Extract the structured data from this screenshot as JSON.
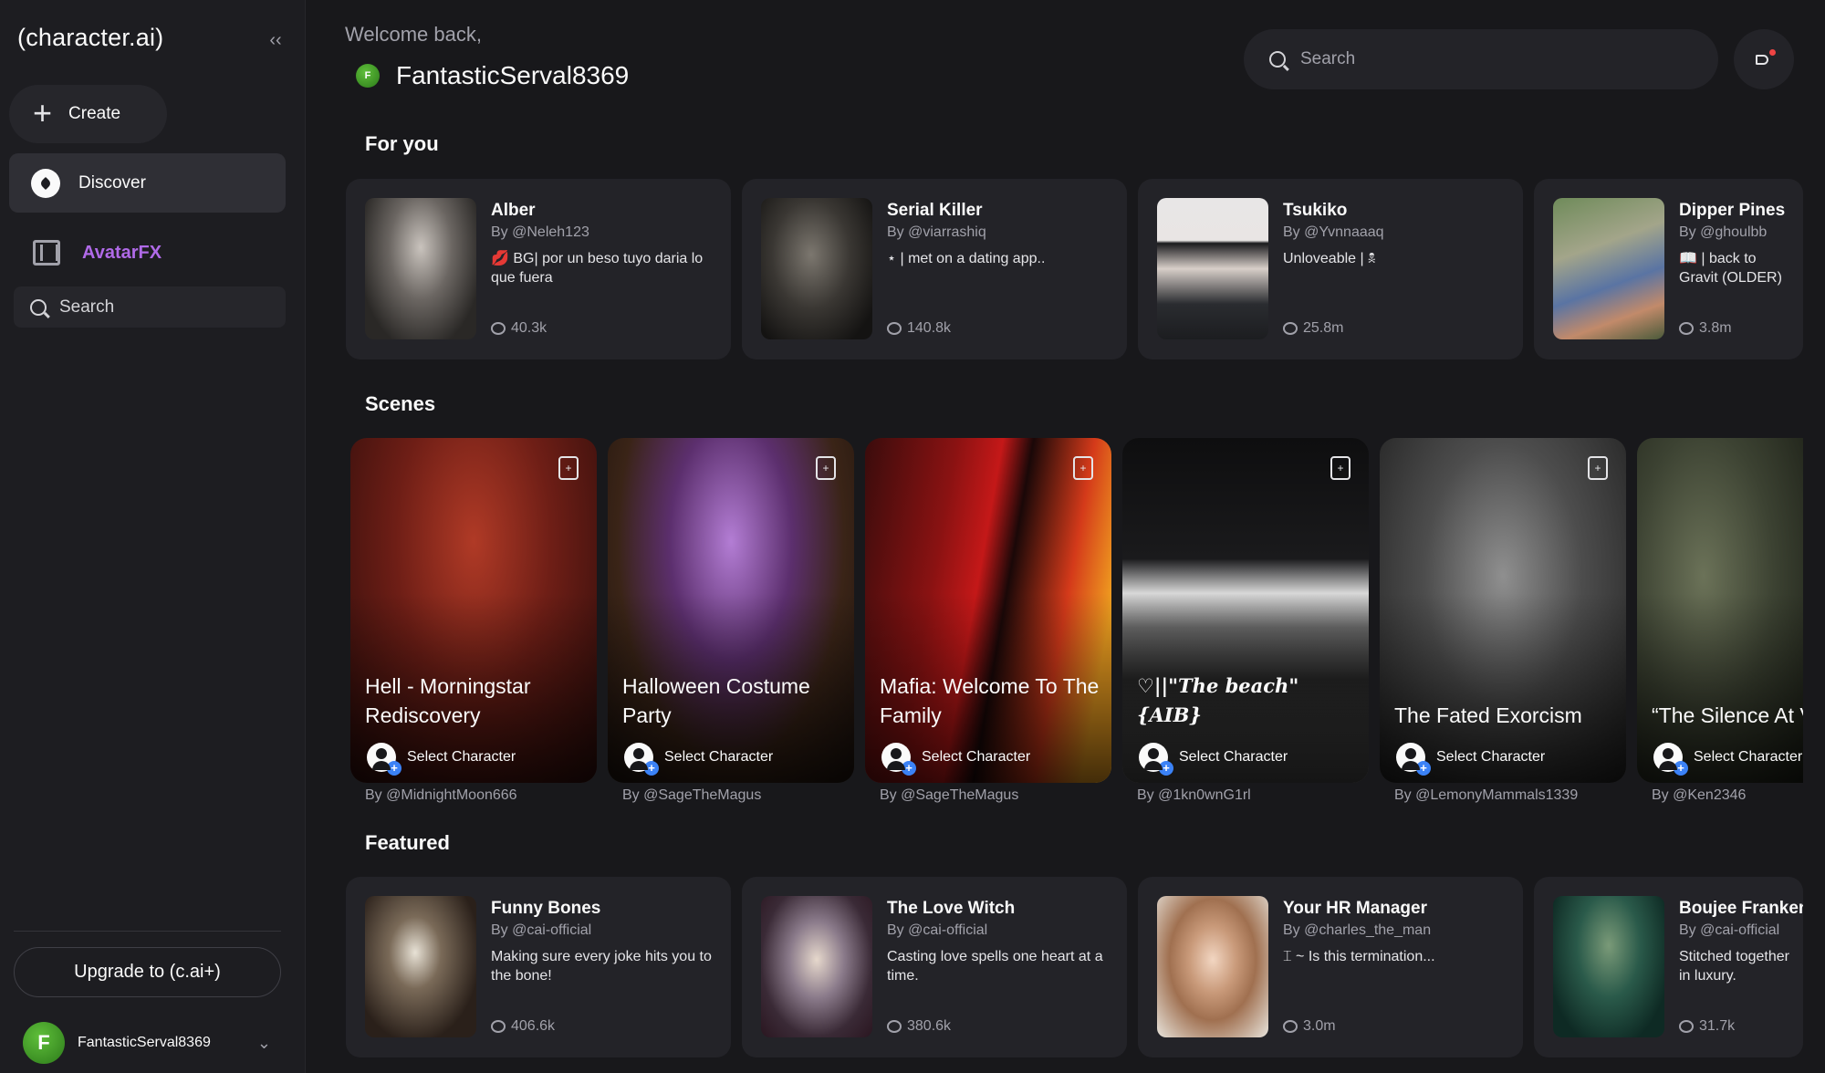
{
  "sidebar": {
    "logo": "(character.ai)",
    "collapse_icon": "‹‹",
    "create_label": "Create",
    "discover_label": "Discover",
    "avatarfx_label": "AvatarFX",
    "search_label": "Search",
    "upgrade_label": "Upgrade to (c.ai+)",
    "user": {
      "initial": "F",
      "name": "FantasticServal8369"
    }
  },
  "header": {
    "welcome": "Welcome back,",
    "initial": "F",
    "username": "FantasticServal8369",
    "search_placeholder": "Search"
  },
  "sections": {
    "for_you": "For you",
    "scenes": "Scenes",
    "featured": "Featured"
  },
  "for_you": [
    {
      "name": "Alber",
      "author": "By @Neleh123",
      "desc": "💋 BG| por un beso tuyo daria lo que fuera",
      "count": "40.3k"
    },
    {
      "name": "Serial Killer",
      "author": "By @viarrashiq",
      "desc": "⋆ | met on a dating app..",
      "count": "140.8k"
    },
    {
      "name": "Tsukiko",
      "author": "By @Yvnnaaaq",
      "desc": "Unloveable | 🕱",
      "count": "25.8m"
    },
    {
      "name": "Dipper Pines",
      "author": "By @ghoulbb",
      "desc": "📖 | back to Gravit (OLDER)",
      "count": "3.8m"
    }
  ],
  "scenes": [
    {
      "title": "Hell - Morningstar Rediscovery",
      "select": "Select Character",
      "author": "By @MidnightMoon666"
    },
    {
      "title": "Halloween Costume Party",
      "select": "Select Character",
      "author": "By @SageTheMagus"
    },
    {
      "title": "Mafia: Welcome To The Family",
      "select": "Select Character",
      "author": "By @SageTheMagus"
    },
    {
      "title": "♡||\"The beach\" {AIB}",
      "select": "Select Character",
      "author": "By @1kn0wnG1rl"
    },
    {
      "title": "The Fated Exorcism",
      "select": "Select Character",
      "author": "By @LemonyMammals1339"
    },
    {
      "title": "“The Silence At V Point”",
      "select": "Select Character",
      "author": "By @Ken2346"
    }
  ],
  "featured": [
    {
      "name": "Funny Bones",
      "author": "By @cai-official",
      "desc": "Making sure every joke hits you to the bone!",
      "count": "406.6k"
    },
    {
      "name": "The Love Witch",
      "author": "By @cai-official",
      "desc": "Casting love spells one heart at a time.",
      "count": "380.6k"
    },
    {
      "name": "Your HR Manager",
      "author": "By @charles_the_man",
      "desc": "⌶ ~ Is this termination...",
      "count": "3.0m"
    },
    {
      "name": "Boujee Franken",
      "author": "By @cai-official",
      "desc": "Stitched together in luxury.",
      "count": "31.7k"
    }
  ],
  "colors": {
    "background": "#18181b",
    "card": "#232328",
    "accent_avatarfx": "#b06ae8",
    "plus_badge": "#3b82f6"
  }
}
